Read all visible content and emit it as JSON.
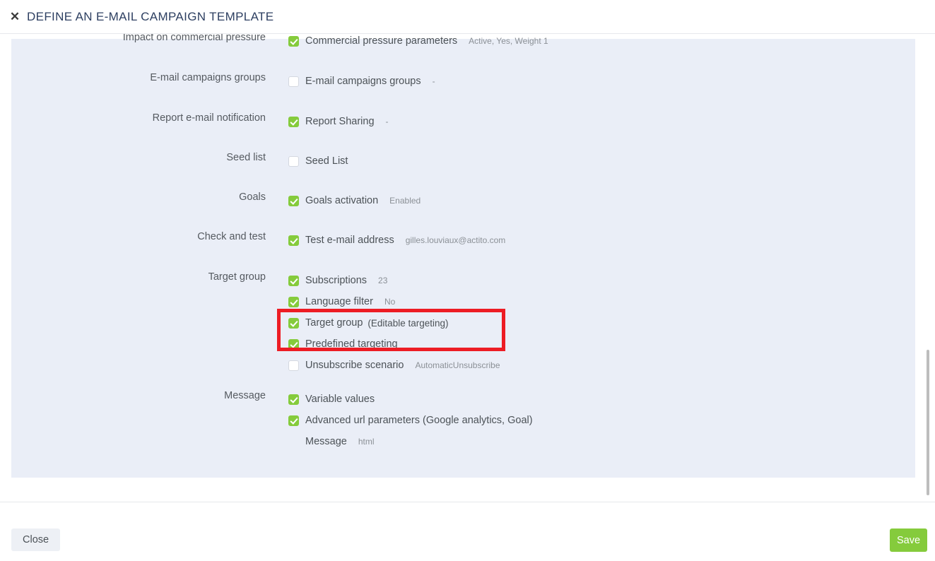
{
  "header": {
    "close_icon": "close-icon",
    "title": "DEFINE AN E-MAIL CAMPAIGN TEMPLATE"
  },
  "colors": {
    "accent_green": "#85cb3c",
    "panel_bg": "#eaeef7",
    "title_navy": "#2d3f61",
    "annotation_red": "#ed1c24"
  },
  "form": {
    "rows": [
      {
        "label": "Impact on commercial pressure",
        "fields": [
          {
            "checked": true,
            "label": "Commercial pressure parameters",
            "value": "Active, Yes, Weight 1"
          }
        ]
      },
      {
        "label": "E-mail campaigns groups",
        "fields": [
          {
            "checked": false,
            "label": "E-mail campaigns groups",
            "value": "-"
          }
        ]
      },
      {
        "label": "Report e-mail notification",
        "fields": [
          {
            "checked": true,
            "label": "Report Sharing",
            "value": "-"
          }
        ]
      },
      {
        "label": "Seed list",
        "fields": [
          {
            "checked": false,
            "label": "Seed List",
            "value": ""
          }
        ]
      },
      {
        "label": "Goals",
        "fields": [
          {
            "checked": true,
            "label": "Goals activation",
            "value": "Enabled"
          }
        ]
      },
      {
        "label": "Check and test",
        "fields": [
          {
            "checked": true,
            "label": "Test e-mail address",
            "value": "gilles.louviaux@actito.com"
          }
        ]
      },
      {
        "label": "Target group",
        "fields": [
          {
            "checked": true,
            "label": "Subscriptions",
            "value": "23"
          },
          {
            "checked": true,
            "label": "Language filter",
            "value": "No"
          },
          {
            "checked": true,
            "label": "Target group",
            "paren": "(Editable targeting)",
            "value": ""
          },
          {
            "checked": true,
            "label": "Predefined targeting",
            "value": ""
          },
          {
            "checked": false,
            "label": "Unsubscribe scenario",
            "value": "AutomaticUnsubscribe"
          }
        ]
      },
      {
        "label": "Message",
        "fields": [
          {
            "checked": true,
            "label": "Variable values",
            "value": ""
          },
          {
            "checked": true,
            "label": "Advanced url parameters (Google analytics, Goal)",
            "value": ""
          },
          {
            "plain": true,
            "label": "Message",
            "value": "html"
          }
        ]
      }
    ]
  },
  "annotation": {
    "shape": "rectangle",
    "color": "#ed1c24",
    "highlights": [
      "Target group (Editable targeting)",
      "Predefined targeting"
    ]
  },
  "footer": {
    "close_label": "Close",
    "save_label": "Save"
  }
}
